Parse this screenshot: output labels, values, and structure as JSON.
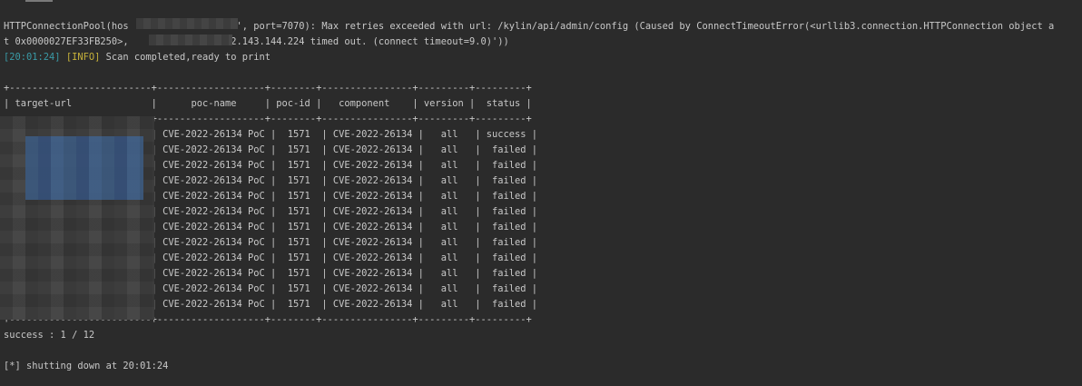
{
  "terminal": {
    "error_line_1": "HTTPConnectionPool(hos                   ', port=7070): Max retries exceeded with url: /kylin/api/admin/config (Caused by ConnectTimeoutError(<urllib3.connection.HTTPConnection object a",
    "error_line_2": "t 0x0000027EF33FB250>,                  2.143.144.224 timed out. (connect timeout=9.0)'))",
    "log_timestamp": "[20:01:24]",
    "log_level": "[INFO]",
    "log_message": " Scan completed,ready to print",
    "table_border": "+-------------------------+-------------------+--------+----------------+---------+---------+",
    "table_header": "| target-url              |      poc-name     | poc-id |   component    | version |  status |",
    "table_rows": [
      "|                         | CVE-2022-26134 PoC |  1571  | CVE-2022-26134 |   all   | success |",
      "|                         | CVE-2022-26134 PoC |  1571  | CVE-2022-26134 |   all   |  failed |",
      "|                         | CVE-2022-26134 PoC |  1571  | CVE-2022-26134 |   all   |  failed |",
      "|                         | CVE-2022-26134 PoC |  1571  | CVE-2022-26134 |   all   |  failed |",
      "|                         | CVE-2022-26134 PoC |  1571  | CVE-2022-26134 |   all   |  failed |",
      "|                         | CVE-2022-26134 PoC |  1571  | CVE-2022-26134 |   all   |  failed |",
      "|                         | CVE-2022-26134 PoC |  1571  | CVE-2022-26134 |   all   |  failed |",
      "|                         | CVE-2022-26134 PoC |  1571  | CVE-2022-26134 |   all   |  failed |",
      "|                         | CVE-2022-26134 PoC |  1571  | CVE-2022-26134 |   all   |  failed |",
      "|                         | CVE-2022-26134 PoC |  1571  | CVE-2022-26134 |   all   |  failed |",
      "|                         | CVE-2022-26134 PoC |  1571  | CVE-2022-26134 |   all   |  failed |",
      "|                         | CVE-2022-26134 PoC |  1571  | CVE-2022-26134 |   all   |  failed |"
    ],
    "summary": "success : 1 / 12",
    "shutdown": "[*] shutting down at 20:01:24"
  },
  "colors": {
    "background": "#2b2b2b",
    "text": "#c8c8c8",
    "timestamp": "#3a9aa6",
    "info": "#c7b23a"
  }
}
